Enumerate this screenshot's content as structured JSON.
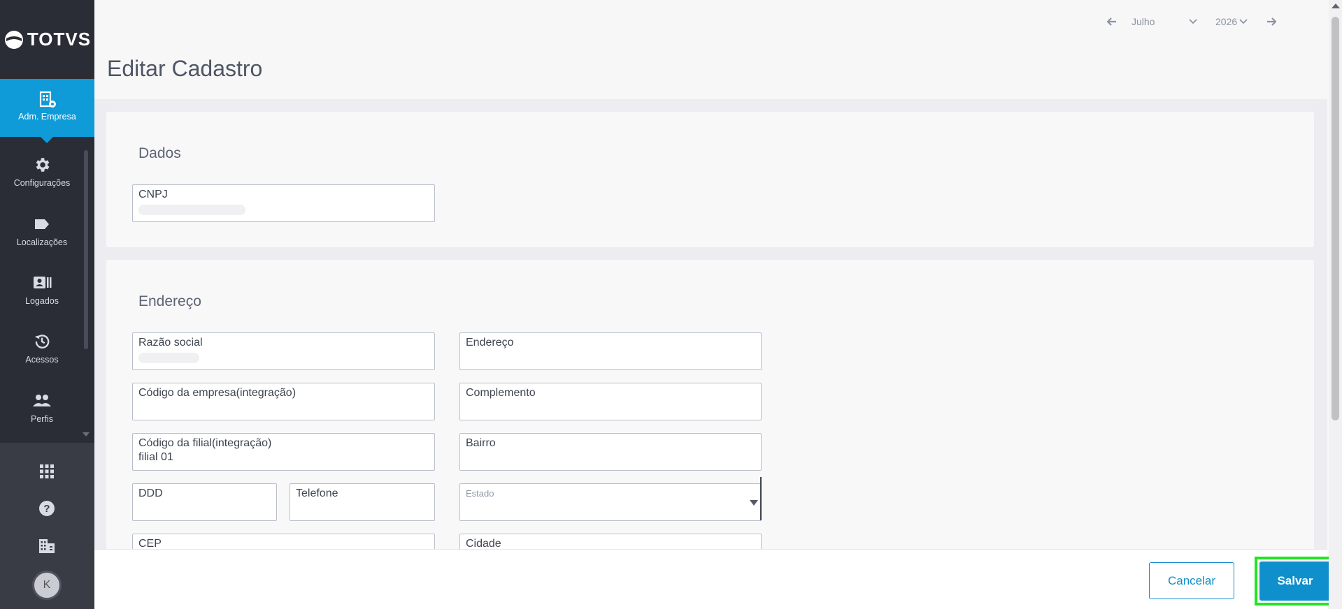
{
  "brand": {
    "name": "TOTVS"
  },
  "sidebar": {
    "active": {
      "label": "Adm. Empresa",
      "icon": "building-gear-icon"
    },
    "items": [
      {
        "label": "Configurações",
        "icon": "gear-icon"
      },
      {
        "label": "Localizações",
        "icon": "tag-icon"
      },
      {
        "label": "Logados",
        "icon": "id-card-icon"
      },
      {
        "label": "Acessos",
        "icon": "history-icon"
      },
      {
        "label": "Perfis",
        "icon": "people-icon"
      }
    ],
    "bottom": {
      "apps_icon": "apps-grid-icon",
      "help_icon": "help-icon",
      "company_icon": "company-icon",
      "avatar_initial": "K"
    }
  },
  "period": {
    "month": "Julho",
    "year": "2026"
  },
  "page": {
    "title": "Editar Cadastro"
  },
  "sections": {
    "dados": {
      "title": "Dados",
      "cnpj": {
        "label": "CNPJ",
        "value": ""
      }
    },
    "endereco": {
      "title": "Endereço",
      "razao_social": {
        "label": "Razão social",
        "value": ""
      },
      "codigo_empresa": {
        "label": "Código da empresa(integração)",
        "value": ""
      },
      "codigo_filial": {
        "label": "Código da filial(integração)",
        "value": "filial 01"
      },
      "ddd": {
        "label": "DDD",
        "value": ""
      },
      "telefone": {
        "label": "Telefone",
        "value": ""
      },
      "cep": {
        "label": "CEP",
        "value": ""
      },
      "endereco": {
        "label": "Endereço",
        "value": ""
      },
      "complemento": {
        "label": "Complemento",
        "value": ""
      },
      "bairro": {
        "label": "Bairro",
        "value": ""
      },
      "estado": {
        "label": "Estado",
        "value": ""
      },
      "cidade": {
        "label": "Cidade",
        "value": ""
      }
    }
  },
  "footer": {
    "cancel_label": "Cancelar",
    "save_label": "Salvar"
  },
  "colors": {
    "accent": "#0f8fcb",
    "sidebar": "#2b2d36",
    "highlight": "#1fe61f"
  }
}
